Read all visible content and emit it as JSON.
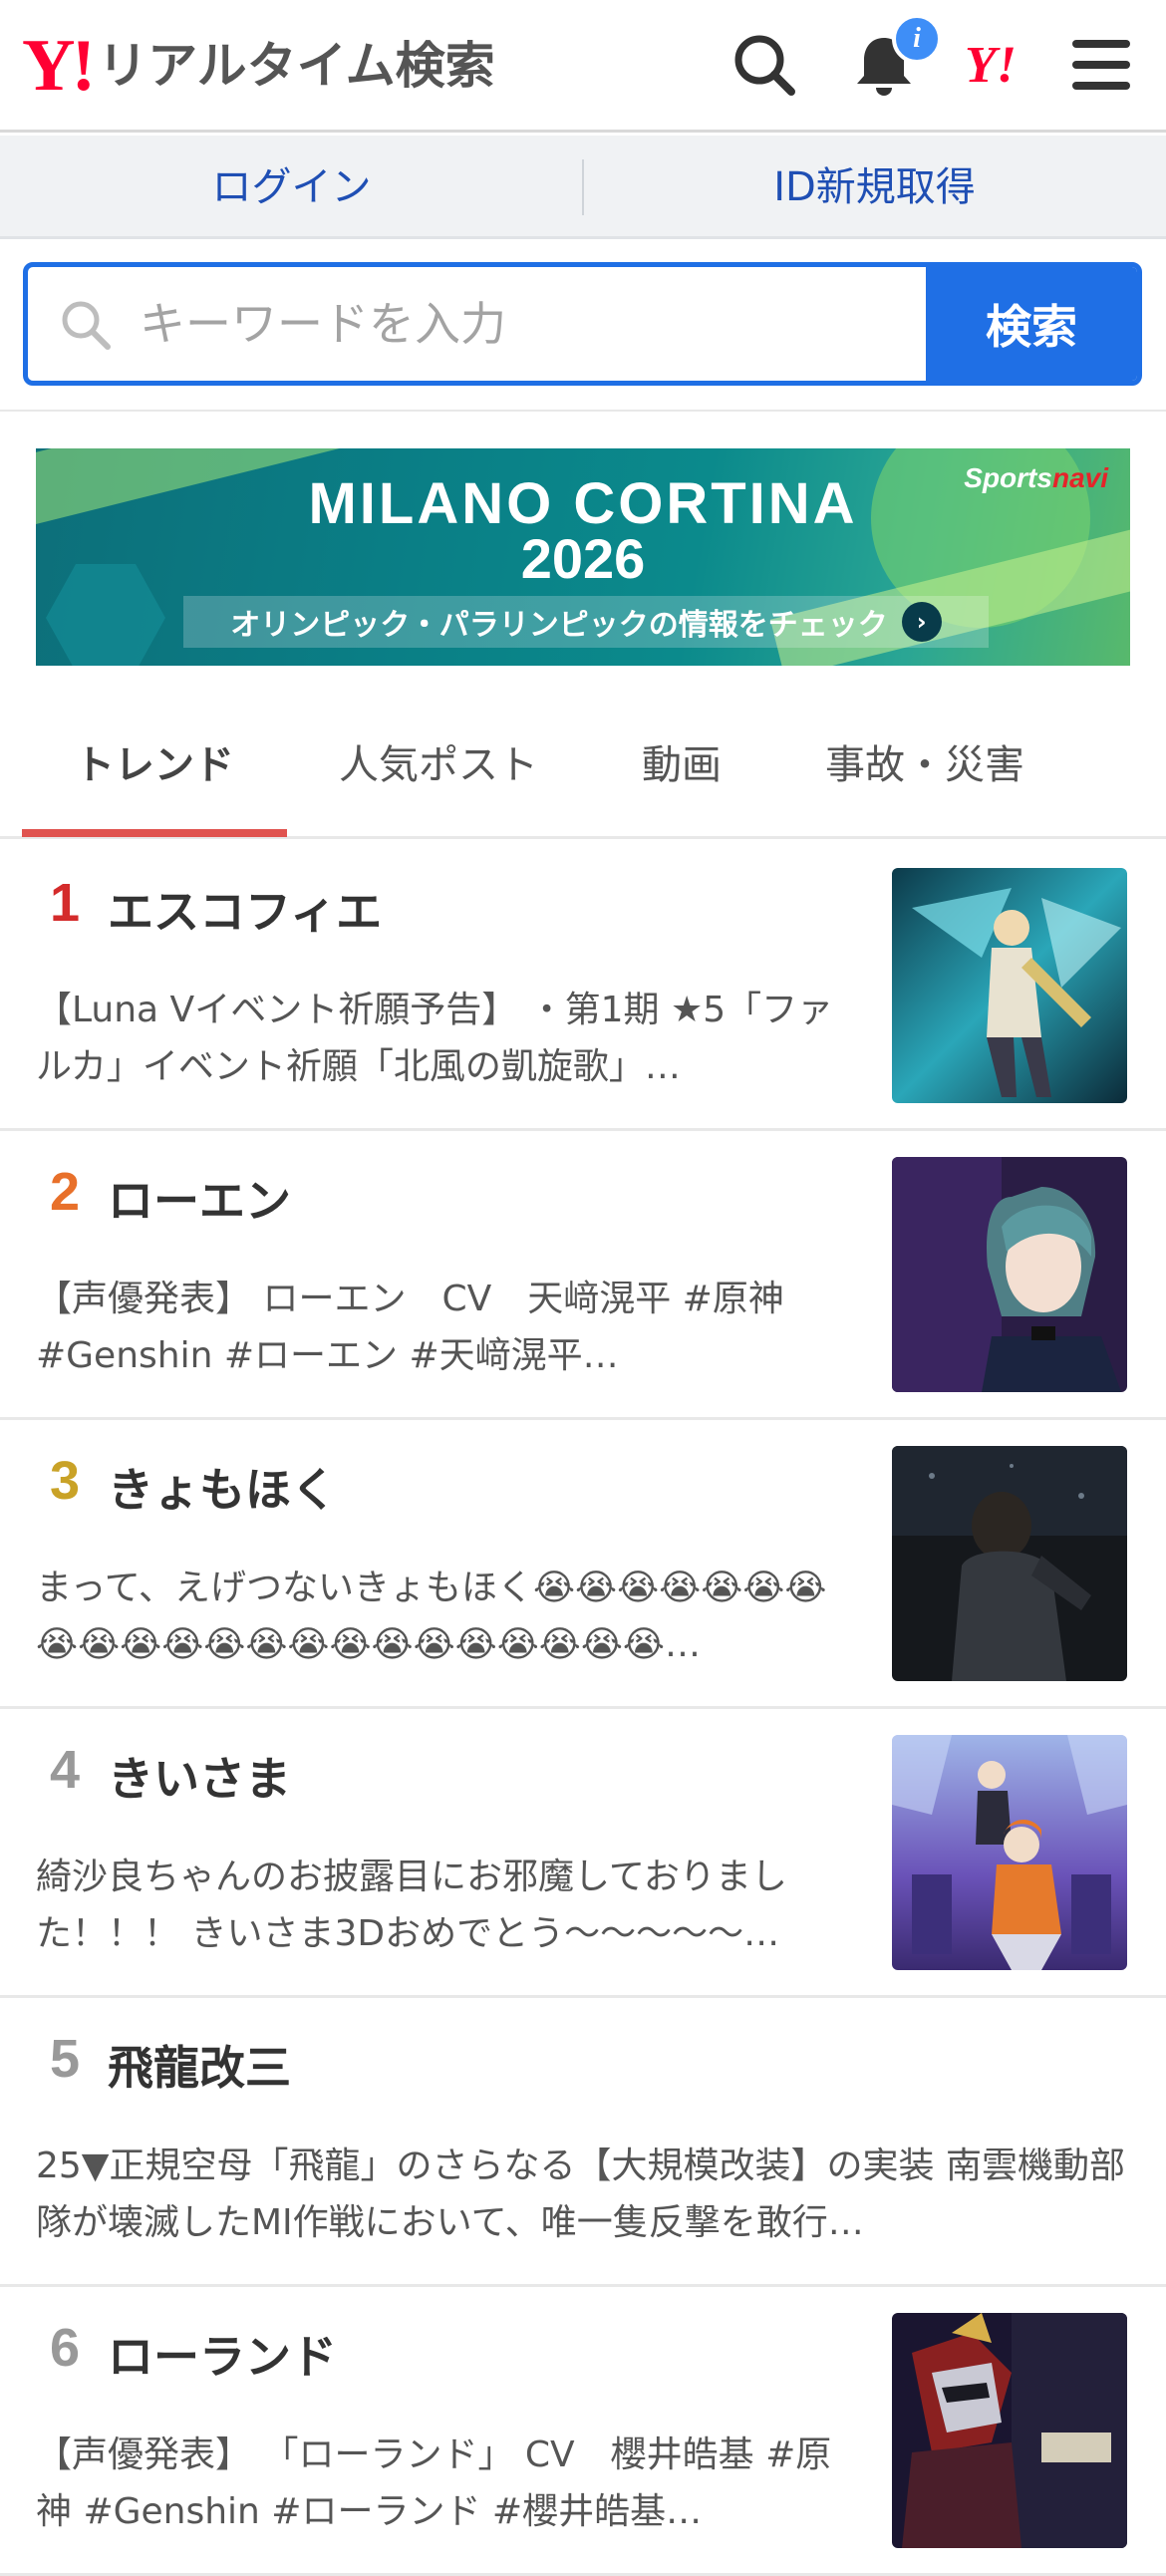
{
  "header": {
    "logo_mark": "Y!",
    "logo_text": "リアルタイム検索",
    "notification_badge": "i",
    "yj_mark": "Y!"
  },
  "account": {
    "login_label": "ログイン",
    "signup_label": "ID新規取得"
  },
  "search": {
    "placeholder": "キーワードを入力",
    "button_label": "検索"
  },
  "banner": {
    "title_line1": "MILANO CORTINA",
    "title_line2": "2026",
    "brand_part1": "Sports",
    "brand_part2": "navi",
    "cta": "オリンピック・パラリンピックの情報をチェック",
    "cta_arrow": "›"
  },
  "tabs": [
    {
      "label": "トレンド",
      "active": true
    },
    {
      "label": "人気ポスト",
      "active": false
    },
    {
      "label": "動画",
      "active": false
    },
    {
      "label": "事故・災害",
      "active": false
    }
  ],
  "trends": [
    {
      "rank": "1",
      "name": "エスコフィエ",
      "desc": "【Luna Vイベント祈願予告】 ・第1期 ★5「ファルカ」イベント祈願「北風の凱旋歌」…",
      "thumb": "anime-knight-thumbnail"
    },
    {
      "rank": "2",
      "name": "ローエン",
      "desc": "【声優発表】 ローエン　CV　天﨑滉平 #原神 #Genshin #ローエン #天﨑滉平…",
      "thumb": "anime-character-thumbnail"
    },
    {
      "rank": "3",
      "name": "きょもほく",
      "desc": "まって、えげつないきょもほく😭😭😭😭😭😭😭😭😭😭😭😭😭😭😭😭😭😭😭😭😭😭…",
      "thumb": "performer-photo-thumbnail"
    },
    {
      "rank": "4",
      "name": "きいさま",
      "desc": "綺沙良ちゃんのお披露目にお邪魔しておりました！！！ きいさま3Dおめでとう〜〜〜〜〜…",
      "thumb": "vtuber-stage-thumbnail"
    },
    {
      "rank": "5",
      "name": "飛龍改三",
      "desc": "25▼正規空母「飛龍」のさらなる【大規模改装】の実装 南雲機動部隊が壊滅したMI作戦において、唯一隻反撃を敢行…",
      "thumb": ""
    },
    {
      "rank": "6",
      "name": "ローランド",
      "desc": "【声優発表】 「ローランド」 CV　櫻井皓基 #原神 #Genshin #ローランド #櫻井皓基…",
      "thumb": "anime-armored-thumbnail"
    }
  ],
  "colors": {
    "brand_red": "#ff0033",
    "link_blue": "#1f4fb4",
    "search_blue": "#1f6fe5",
    "tab_underline": "#e0534f",
    "rank1": "#d42b2b",
    "rank2": "#e8702a",
    "rank3": "#c9a227",
    "rank_other": "#999999"
  }
}
